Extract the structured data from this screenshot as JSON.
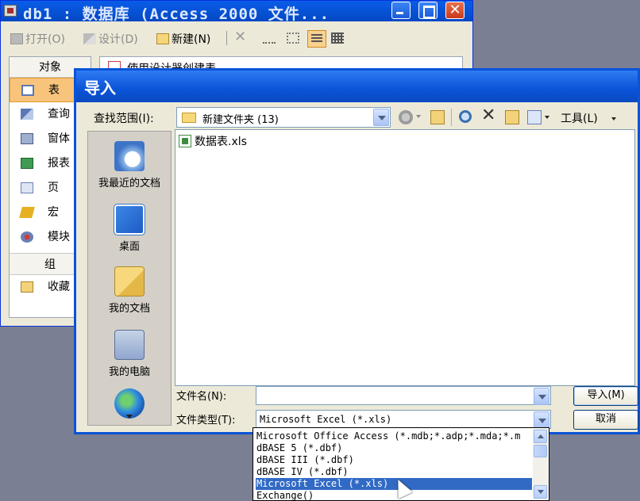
{
  "db_window": {
    "title": "db1 : 数据库 (Access 2000 文件...",
    "toolbar": {
      "open": "打开(O)",
      "design": "设计(D)",
      "new": "新建(N)"
    },
    "objects_header": "对象",
    "objects": [
      "表",
      "查询",
      "窗体",
      "报表",
      "页",
      "宏",
      "模块"
    ],
    "groups_header": "组",
    "favorites": "收藏",
    "list_item": "使用设计器创建表"
  },
  "dialog": {
    "title": "导入",
    "look_in_label": "查找范围(I):",
    "look_in_value": "新建文件夹 (13)",
    "tools_label": "工具(L)",
    "places": [
      "我最近的文档",
      "桌面",
      "我的文档",
      "我的电脑"
    ],
    "files": [
      "数据表.xls"
    ],
    "file_name_label": "文件名(N):",
    "file_name_value": "",
    "file_type_label": "文件类型(T):",
    "file_type_value": "Microsoft Excel (*.xls)",
    "import_button": "导入(M)",
    "cancel_button": "取消"
  },
  "file_type_options": [
    "Microsoft Office Access (*.mdb;*.adp;*.mda;*.m",
    "dBASE 5 (*.dbf)",
    "dBASE III (*.dbf)",
    "dBASE IV (*.dbf)",
    "Microsoft Excel (*.xls)",
    "Exchange()"
  ],
  "selected_option_index": 4,
  "colors": {
    "titlebar": "#0a53d8",
    "selection": "#316ac5",
    "selected_object": "#f8c47c",
    "desktop": "#7b7f93"
  }
}
